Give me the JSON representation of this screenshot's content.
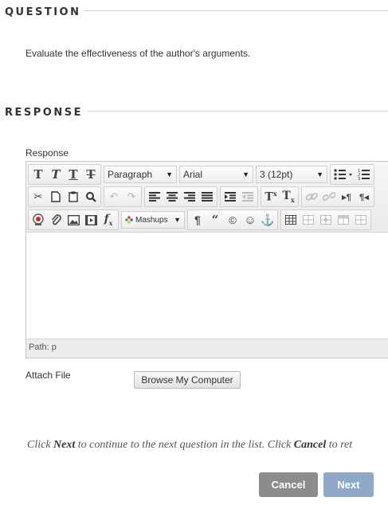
{
  "question": {
    "heading": "QUESTION",
    "text": "Evaluate the effectiveness of the author's arguments."
  },
  "response": {
    "heading": "RESPONSE",
    "label": "Response",
    "editor": {
      "format_select": "Paragraph",
      "font_select": "Arial",
      "size_select": "3 (12pt)",
      "mashups_label": "Mashups",
      "path_label": "Path:",
      "path_value": "p"
    }
  },
  "attach": {
    "label": "Attach File",
    "browse_button": "Browse My Computer"
  },
  "instructions": {
    "part1": "Click ",
    "next_word": "Next",
    "part2": " to continue to the next question in the list. Click ",
    "cancel_word": "Cancel",
    "part3": " to ret"
  },
  "buttons": {
    "cancel": "Cancel",
    "next": "Next"
  },
  "colors": {
    "cancel_bg": "#8c8c8c",
    "next_bg": "#8ea9c8"
  }
}
